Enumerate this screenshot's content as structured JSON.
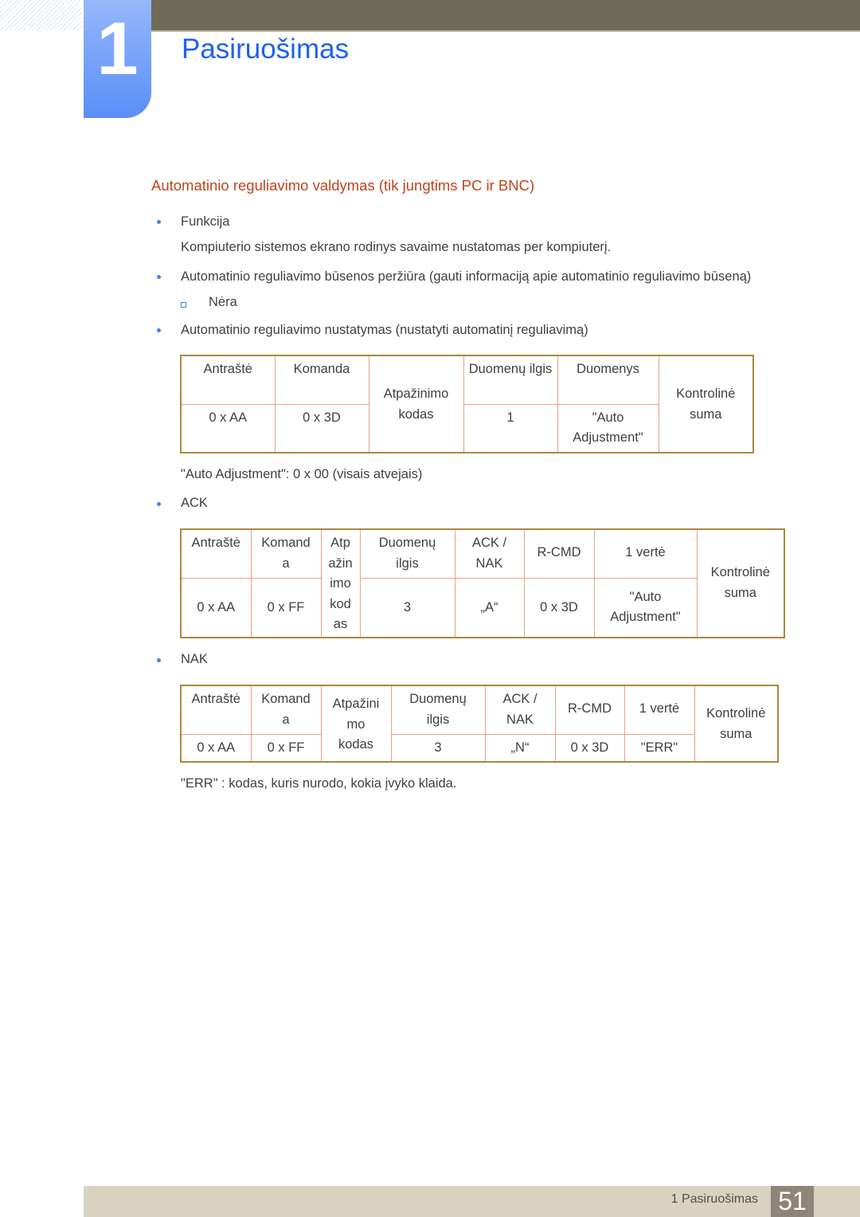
{
  "chapter": {
    "number": "1",
    "title": "Pasiruošimas"
  },
  "section": {
    "heading": "Automatinio reguliavimo valdymas (tik jungtims PC ir BNC)"
  },
  "bullets": [
    {
      "label": "Funkcija",
      "description": "Kompiuterio sistemos ekrano rodinys savaime nustatomas per kompiuterį."
    },
    {
      "label": "Automatinio reguliavimo būsenos peržiūra (gauti informaciją apie automatinio reguliavimo būseną)",
      "sub_items": [
        "Nėra"
      ]
    },
    {
      "label": "Automatinio reguliavimo nustatymas (nustatyti automatinį reguliavimą)"
    }
  ],
  "table_set": {
    "headers": {
      "header": "Antraštė",
      "command": "Komanda",
      "id_code": "Atpažinimo kodas",
      "data_length": "Duomenų ilgis",
      "data": "Duomenys",
      "checksum": "Kontrolinė suma"
    },
    "values": {
      "header": "0 x AA",
      "command": "0 x 3D",
      "data_length": "1",
      "data": "\"Auto Adjustment\""
    }
  },
  "auto_adjustment_note": "\"Auto Adjustment\": 0 x 00 (visais atvejais)",
  "ack": {
    "label": "ACK",
    "headers": {
      "header": "Antraštė",
      "command_l1": "Komand",
      "command_l2": "a",
      "id_code_l1": "Atp",
      "id_code_l2": "ažin",
      "id_code_l3": "imo",
      "id_code_l4": "kod",
      "id_code_l5": "as",
      "data_length_l1": "Duomenų",
      "data_length_l2": "ilgis",
      "acknak_l1": "ACK /",
      "acknak_l2": "NAK",
      "rcmd": "R-CMD",
      "value1": "1 vertė",
      "checksum_l1": "Kontrolinė",
      "checksum_l2": "suma"
    },
    "values": {
      "header": "0 x AA",
      "command": "0 x FF",
      "data_length": "3",
      "acknak": "„A“",
      "rcmd": "0 x 3D",
      "value1_l1": "\"Auto",
      "value1_l2": "Adjustment\""
    }
  },
  "nak": {
    "label": "NAK",
    "headers": {
      "header": "Antraštė",
      "command_l1": "Komand",
      "command_l2": "a",
      "id_code_l1": "Atpažini",
      "id_code_l2": "mo",
      "id_code_l3": "kodas",
      "data_length_l1": "Duomenų",
      "data_length_l2": "ilgis",
      "acknak_l1": "ACK /",
      "acknak_l2": "NAK",
      "rcmd": "R-CMD",
      "value1": "1 vertė",
      "checksum_l1": "Kontrolinė",
      "checksum_l2": "suma"
    },
    "values": {
      "header": "0 x AA",
      "command": "0 x FF",
      "data_length": "3",
      "acknak": "„N“",
      "rcmd": "0 x 3D",
      "value1": "\"ERR\""
    }
  },
  "err_note": "\"ERR\" : kodas, kuris nurodo, kokia įvyko klaida.",
  "footer": {
    "chapter_label": "1 Pasiruošimas",
    "page_number": "51"
  },
  "colors": {
    "chapter_title": "#1d62f0",
    "section_heading": "#c4431a",
    "bullet": "#3f83e8",
    "table_outer_border": "#a9893c",
    "table_inner_border": "#e9a184"
  }
}
